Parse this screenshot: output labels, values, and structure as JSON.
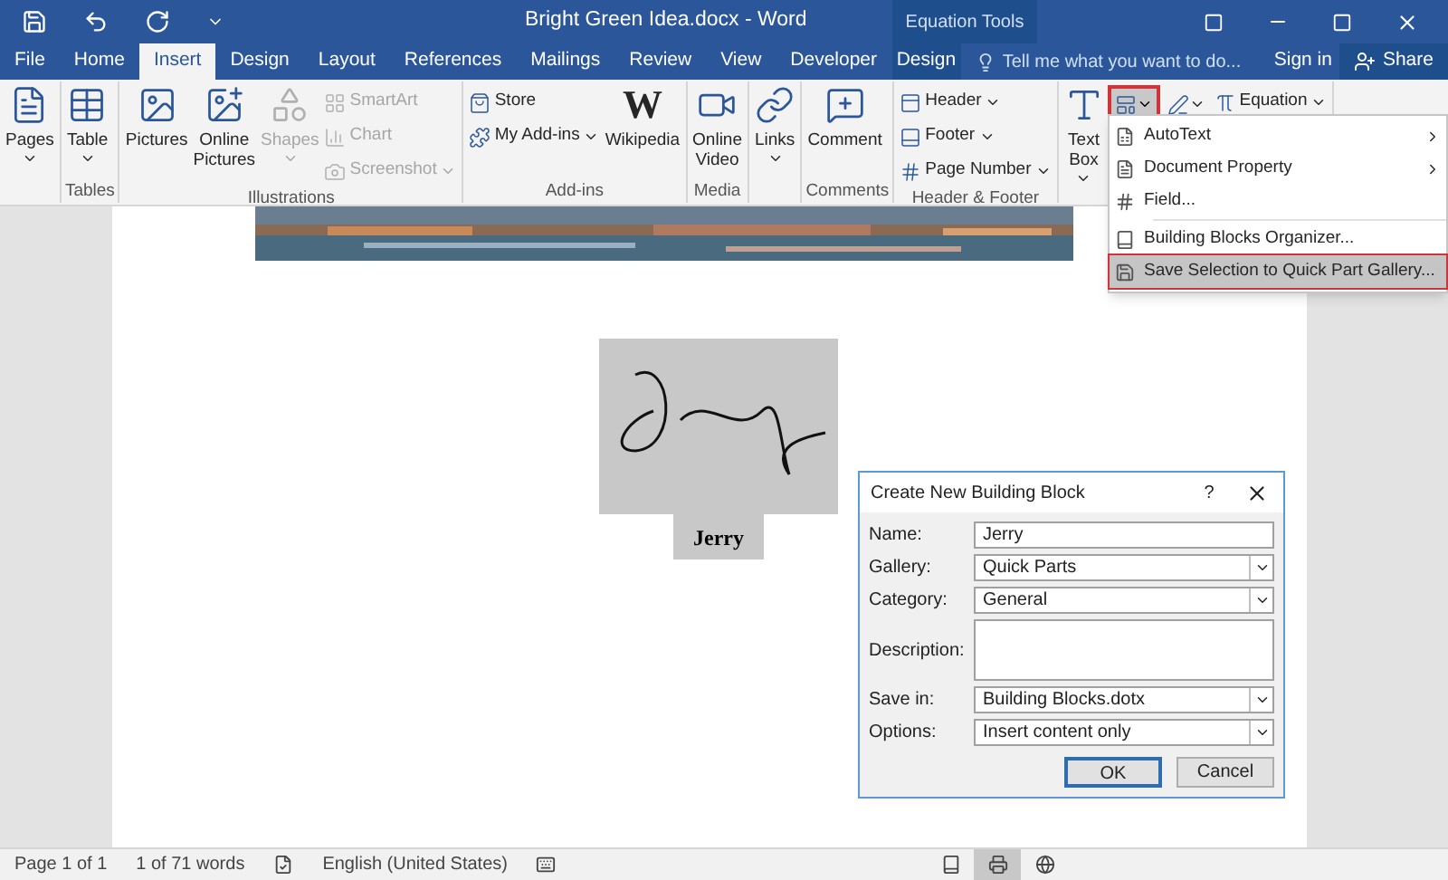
{
  "window": {
    "title": "Bright Green Idea.docx - Word",
    "contextual_header": "Equation Tools"
  },
  "tabs": [
    {
      "label": "File",
      "selected": false,
      "kind": "normal"
    },
    {
      "label": "Home",
      "selected": false,
      "kind": "normal"
    },
    {
      "label": "Insert",
      "selected": true,
      "kind": "normal"
    },
    {
      "label": "Design",
      "selected": false,
      "kind": "normal"
    },
    {
      "label": "Layout",
      "selected": false,
      "kind": "normal"
    },
    {
      "label": "References",
      "selected": false,
      "kind": "normal"
    },
    {
      "label": "Mailings",
      "selected": false,
      "kind": "normal"
    },
    {
      "label": "Review",
      "selected": false,
      "kind": "normal"
    },
    {
      "label": "View",
      "selected": false,
      "kind": "normal"
    },
    {
      "label": "Developer",
      "selected": false,
      "kind": "normal"
    },
    {
      "label": "Design",
      "selected": false,
      "kind": "contextual"
    }
  ],
  "tell_me": {
    "placeholder": "Tell me what you want to do..."
  },
  "account": {
    "sign_in": "Sign in",
    "share": "Share"
  },
  "ribbon_groups": [
    {
      "items": [
        {
          "label": "Pages",
          "kind": "large",
          "disabled": false,
          "dropdown": true
        }
      ]
    },
    {
      "label": "Tables",
      "items": [
        {
          "label": "Table",
          "kind": "large",
          "disabled": false,
          "dropdown": true
        }
      ]
    },
    {
      "label": "Illustrations",
      "items": [
        {
          "label": "Pictures",
          "kind": "large",
          "disabled": false,
          "dropdown": false
        },
        {
          "label": "Online Pictures",
          "kind": "large",
          "disabled": false,
          "dropdown": false
        },
        {
          "label": "Shapes",
          "kind": "large",
          "disabled": true,
          "dropdown": true
        },
        {
          "label": "SmartArt",
          "kind": "small",
          "disabled": true,
          "dropdown": false
        },
        {
          "label": "Chart",
          "kind": "small",
          "disabled": true,
          "dropdown": false
        },
        {
          "label": "Screenshot",
          "kind": "small",
          "disabled": true,
          "dropdown": true
        }
      ]
    },
    {
      "label": "Add-ins",
      "items": [
        {
          "label": "Store",
          "kind": "small",
          "disabled": false,
          "dropdown": false
        },
        {
          "label": "My Add-ins",
          "kind": "small",
          "disabled": false,
          "dropdown": true
        },
        {
          "label": "Wikipedia",
          "kind": "large",
          "disabled": false,
          "dropdown": false,
          "logo_text": "W"
        }
      ]
    },
    {
      "label": "Media",
      "items": [
        {
          "label": "Online Video",
          "kind": "large",
          "disabled": false,
          "dropdown": false
        }
      ]
    },
    {
      "items": [
        {
          "label": "Links",
          "kind": "large",
          "disabled": false,
          "dropdown": true
        }
      ]
    },
    {
      "label": "Comments",
      "items": [
        {
          "label": "Comment",
          "kind": "large",
          "disabled": false,
          "dropdown": false
        }
      ]
    },
    {
      "label": "Header & Footer",
      "items": [
        {
          "label": "Header",
          "kind": "small",
          "disabled": false,
          "dropdown": true
        },
        {
          "label": "Footer",
          "kind": "small",
          "disabled": false,
          "dropdown": true
        },
        {
          "label": "Page Number",
          "kind": "small",
          "disabled": false,
          "dropdown": true
        }
      ]
    },
    {
      "items": [
        {
          "label": "Text Box",
          "kind": "large",
          "disabled": false,
          "dropdown": true
        },
        {
          "kind": "quickparts",
          "disabled": false,
          "dropdown": true
        },
        {
          "kind": "iconmenu",
          "disabled": false,
          "dropdown": true
        },
        {
          "label": "Equation",
          "kind": "small",
          "disabled": false,
          "dropdown": true
        }
      ]
    }
  ],
  "quick_parts_menu": [
    {
      "label": "AutoText",
      "submenu": true,
      "selected": false
    },
    {
      "label": "Document Property",
      "submenu": true,
      "selected": false
    },
    {
      "label": "Field...",
      "submenu": false,
      "selected": false
    },
    {
      "label": "Building Blocks Organizer...",
      "submenu": false,
      "selected": false
    },
    {
      "label": "Save Selection to Quick Part Gallery...",
      "submenu": false,
      "selected": true
    }
  ],
  "document": {
    "caption": "Jerry"
  },
  "dialog": {
    "title": "Create New Building Block",
    "help": "?",
    "fields": [
      {
        "label": "Name:",
        "kind": "text",
        "value": "Jerry"
      },
      {
        "label": "Gallery:",
        "kind": "select",
        "value": "Quick Parts"
      },
      {
        "label": "Category:",
        "kind": "select",
        "value": "General"
      },
      {
        "label": "Description:",
        "kind": "textarea"
      },
      {
        "label": "Save in:",
        "kind": "select",
        "value": "Building Blocks.dotx"
      },
      {
        "label": "Options:",
        "kind": "select",
        "value": "Insert content only"
      }
    ],
    "buttons": [
      {
        "label": "OK",
        "default": true
      },
      {
        "label": "Cancel",
        "default": false
      }
    ]
  },
  "status_bar": {
    "page": "Page 1 of 1",
    "words": "1 of 71 words",
    "language": "English (United States)",
    "views": [
      {
        "selected": false
      },
      {
        "selected": true
      },
      {
        "selected": false
      }
    ]
  }
}
